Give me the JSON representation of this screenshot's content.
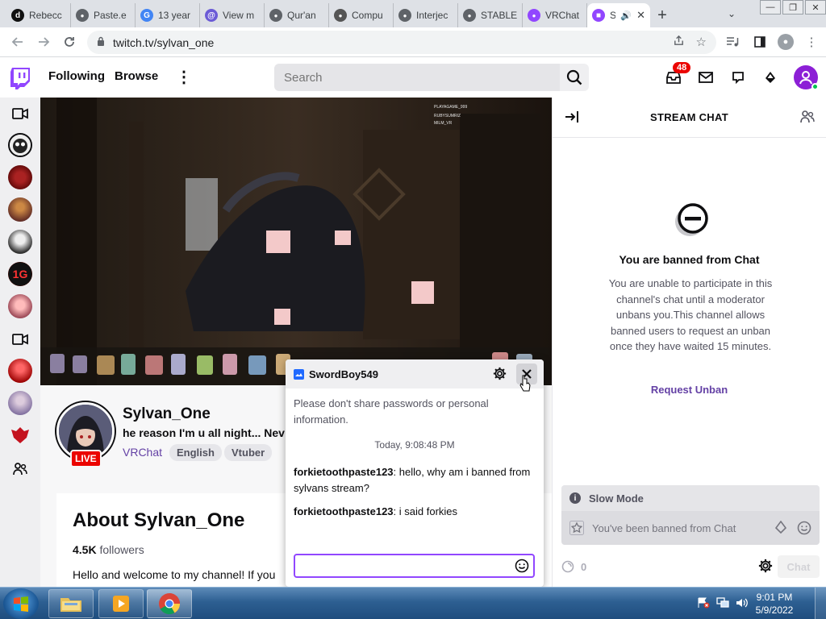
{
  "browser": {
    "tabs": [
      {
        "label": "Rebecc",
        "icon": "d-logo-icon",
        "fav": "d",
        "fav_color": "#111111"
      },
      {
        "label": "Paste.e",
        "icon": "globe-icon",
        "fav": "",
        "fav_color": "#5f6368"
      },
      {
        "label": "13 year",
        "icon": "google-icon",
        "fav": "G",
        "fav_color": "#4285f4"
      },
      {
        "label": "View m",
        "icon": "at-sign-icon",
        "fav": "@",
        "fav_color": "#6b5bd6"
      },
      {
        "label": "Qur'an",
        "icon": "globe-icon",
        "fav": "",
        "fav_color": "#5f6368"
      },
      {
        "label": "Compu",
        "icon": "puzzle-icon",
        "fav": "",
        "fav_color": "#555555"
      },
      {
        "label": "Interjec",
        "icon": "globe-icon",
        "fav": "",
        "fav_color": "#5f6368"
      },
      {
        "label": "STABLE",
        "icon": "globe-icon",
        "fav": "",
        "fav_color": "#5f6368"
      },
      {
        "label": "VRChat",
        "icon": "twitch-icon",
        "fav": "",
        "fav_color": "#9146ff"
      }
    ],
    "active_tab": {
      "label": "S",
      "icon": "twitch-icon"
    },
    "new_tab": "+",
    "url": "twitch.tv/sylvan_one"
  },
  "twitch_nav": {
    "following": "Following",
    "browse": "Browse",
    "search_placeholder": "Search",
    "notification_count": "48"
  },
  "channel": {
    "name": "Sylvan_One",
    "stream_title": "he reason I'm u all night... Nev",
    "game": "VRChat",
    "tags": [
      "English",
      "Vtuber"
    ],
    "live_label": "LIVE",
    "about_title": "About Sylvan_One",
    "followers_count": "4.5K",
    "followers_label": "followers",
    "description": "Hello and welcome to my channel! If you"
  },
  "user_card": {
    "username": "SwordBoy549",
    "warning": "Please don't share passwords or personal information.",
    "timestamp": "Today, 9:08:48 PM",
    "messages": [
      {
        "user": "forkietoothpaste123",
        "text": ": hello, why am i banned from sylvans stream?"
      },
      {
        "user": "forkietoothpaste123",
        "text": ": i said forkies"
      }
    ]
  },
  "chat": {
    "header": "STREAM CHAT",
    "banned_title": "You are banned from Chat",
    "banned_description": "You are unable to participate in this channel's chat until a moderator unbans you.This channel allows banned users to request an unban once they have waited 15 minutes.",
    "request_unban": "Request Unban",
    "slow_mode": "Slow Mode",
    "input_placeholder": "You've been banned from Chat",
    "points": "0",
    "chat_button": "Chat"
  },
  "taskbar": {
    "time": "9:01 PM",
    "date": "5/9/2022"
  },
  "colors": {
    "twitch_purple": "#9146ff",
    "link_purple": "#6441a5",
    "live_red": "#eb0400"
  }
}
